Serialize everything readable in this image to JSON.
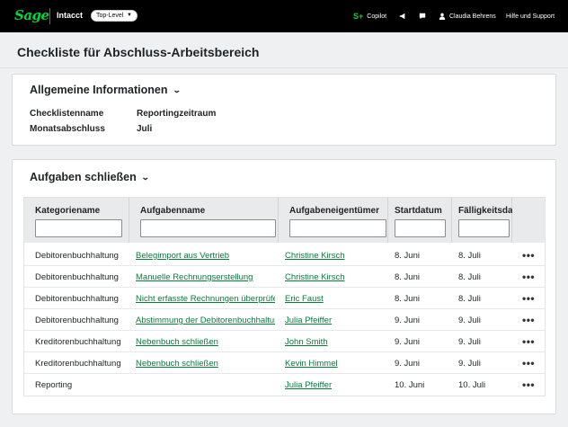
{
  "topbar": {
    "logo": "Sage",
    "product": "Intacct",
    "level": "Top-Level",
    "copilot": "Copilot",
    "user": "Claudia Behrens",
    "help": "Hilfe und Support"
  },
  "page": {
    "title": "Checkliste für Abschluss-Arbeitsbereich"
  },
  "general": {
    "title": "Allgemeine Informationen",
    "rows": [
      {
        "label": "Checklistenname",
        "value": "Reportingzeitraum"
      },
      {
        "label": "Monatsabschluss",
        "value": "Juli"
      }
    ]
  },
  "tasks": {
    "title": "Aufgaben schließen",
    "columns": [
      "Kategoriename",
      "Aufgabenname",
      "Aufgabeneigentümer",
      "Startdatum",
      "Fälligkeitsdatum"
    ],
    "rows": [
      {
        "category": "Debitorenbuchhaltung",
        "task": "Belegimport aus Vertrieb",
        "owner": "Christine Kirsch",
        "start": "8. Juni",
        "due": "8. Juli"
      },
      {
        "category": "Debitorenbuchhaltung",
        "task": "Manuelle Rechnungserstellung",
        "owner": "Christine Kirsch",
        "start": "8. Juni",
        "due": "8. Juli"
      },
      {
        "category": "Debitorenbuchhaltung",
        "task": "Nicht erfasste Rechnungen überprüfen",
        "owner": "Eric Faust",
        "start": "8. Juni",
        "due": "8. Juli"
      },
      {
        "category": "Debitorenbuchhaltung",
        "task": "Abstimmung der Debitorenbuchhaltung",
        "owner": "Julia Pfeiffer",
        "start": "9. Juni",
        "due": "9. Juli"
      },
      {
        "category": "Kreditorenbuchhaltung",
        "task": "Nebenbuch schließen",
        "owner": "John Smith",
        "start": "9. Juni",
        "due": "9. Juli"
      },
      {
        "category": "Kreditorenbuchhaltung",
        "task": "Nebenbuch schließen",
        "owner": "Kevin Himmel",
        "start": "9. Juni",
        "due": "9. Juli"
      },
      {
        "category": "Reporting",
        "task": "",
        "owner": "Julia Pfeiffer",
        "start": "10. Juni",
        "due": "10. Juli"
      }
    ],
    "more_glyph": "•••"
  },
  "colors": {
    "brand": "#00d639",
    "link": "#0b7a3b",
    "topbar": "#000000"
  }
}
